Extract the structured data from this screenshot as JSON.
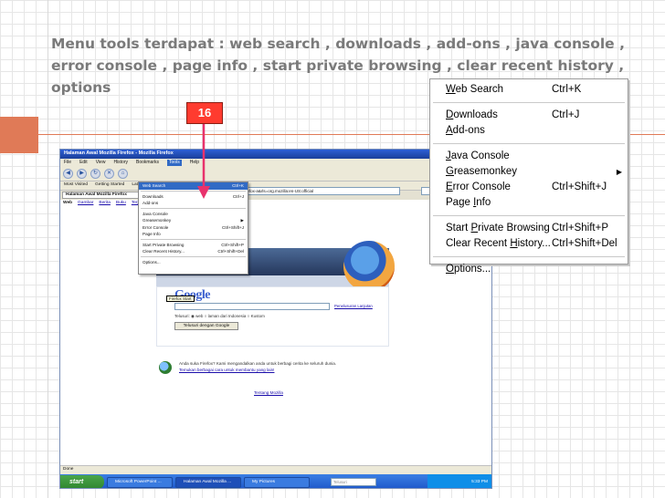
{
  "slide": {
    "title": "Menu tools terdapat : web search , downloads , add-ons , java console , error console , page info , start private browsing , clear recent history , options",
    "step_number": "16"
  },
  "colors": {
    "accent": "#e07a57",
    "badge": "#ff3b2f",
    "title_text": "#7a7a7a"
  },
  "tools_menu": {
    "groups": [
      [
        {
          "label": "Web Search",
          "ul": "W",
          "shortcut": "Ctrl+K"
        }
      ],
      [
        {
          "label": "Downloads",
          "ul": "D",
          "shortcut": "Ctrl+J"
        },
        {
          "label": "Add-ons",
          "ul": "A",
          "shortcut": ""
        }
      ],
      [
        {
          "label": "Java Console",
          "ul": "J",
          "shortcut": ""
        },
        {
          "label": "Greasemonkey",
          "ul": "G",
          "shortcut": "",
          "submenu": true
        },
        {
          "label": "Error Console",
          "ul": "E",
          "shortcut": "Ctrl+Shift+J"
        },
        {
          "label": "Page Info",
          "ul": "I",
          "shortcut": ""
        }
      ],
      [
        {
          "label": "Start Private Browsing",
          "ul": "P",
          "shortcut": "Ctrl+Shift+P"
        },
        {
          "label": "Clear Recent History...",
          "ul": "H",
          "shortcut": "Ctrl+Shift+Del"
        }
      ],
      [
        {
          "label": "Options...",
          "ul": "O",
          "shortcut": ""
        }
      ]
    ]
  },
  "screenshot": {
    "window_title": "Halaman Awal Mozilla Firefox - Mozilla Firefox",
    "menubar": [
      "File",
      "Edit",
      "View",
      "History",
      "Bookmarks",
      "Tools",
      "Help"
    ],
    "active_menu": "Tools",
    "url": "...t=firefox-a&rls=org.mozilla:en-US:official",
    "bookmarks": [
      "Most Visited",
      "Getting Started",
      "Latest Headlines"
    ],
    "tab_title": "Halaman Awal Mozilla Firefox",
    "google_nav": [
      "Web",
      "Gambar",
      "Berita",
      "Buku",
      "Terjemahan"
    ],
    "tooltip": "Firefox Start",
    "google_logo": "Google",
    "advanced_search": "Penelusuran Lanjutan",
    "radio_labels": "Telusuri:  ◉ web  ○ laman dari Indonesia  ○ Kustom",
    "search_button": "Telusuri dengan Google",
    "promo_line1": "Anda suka Firefox? Kami mengandalkan anda untuk berbagi cerita ke seluruh dunia.",
    "promo_line2": "Temukan berbagai cara untuk membantu yang lain!",
    "about_link": "Tentang Mozilla",
    "status": "Done",
    "taskbar_start": "start",
    "taskbar_items": [
      "Microsoft PowerPoint ...",
      "Halaman Awal Mozilla ...",
      "My Pictures"
    ],
    "tray_search_placeholder": "Telusuri",
    "tray_time": "5:33 PM"
  }
}
